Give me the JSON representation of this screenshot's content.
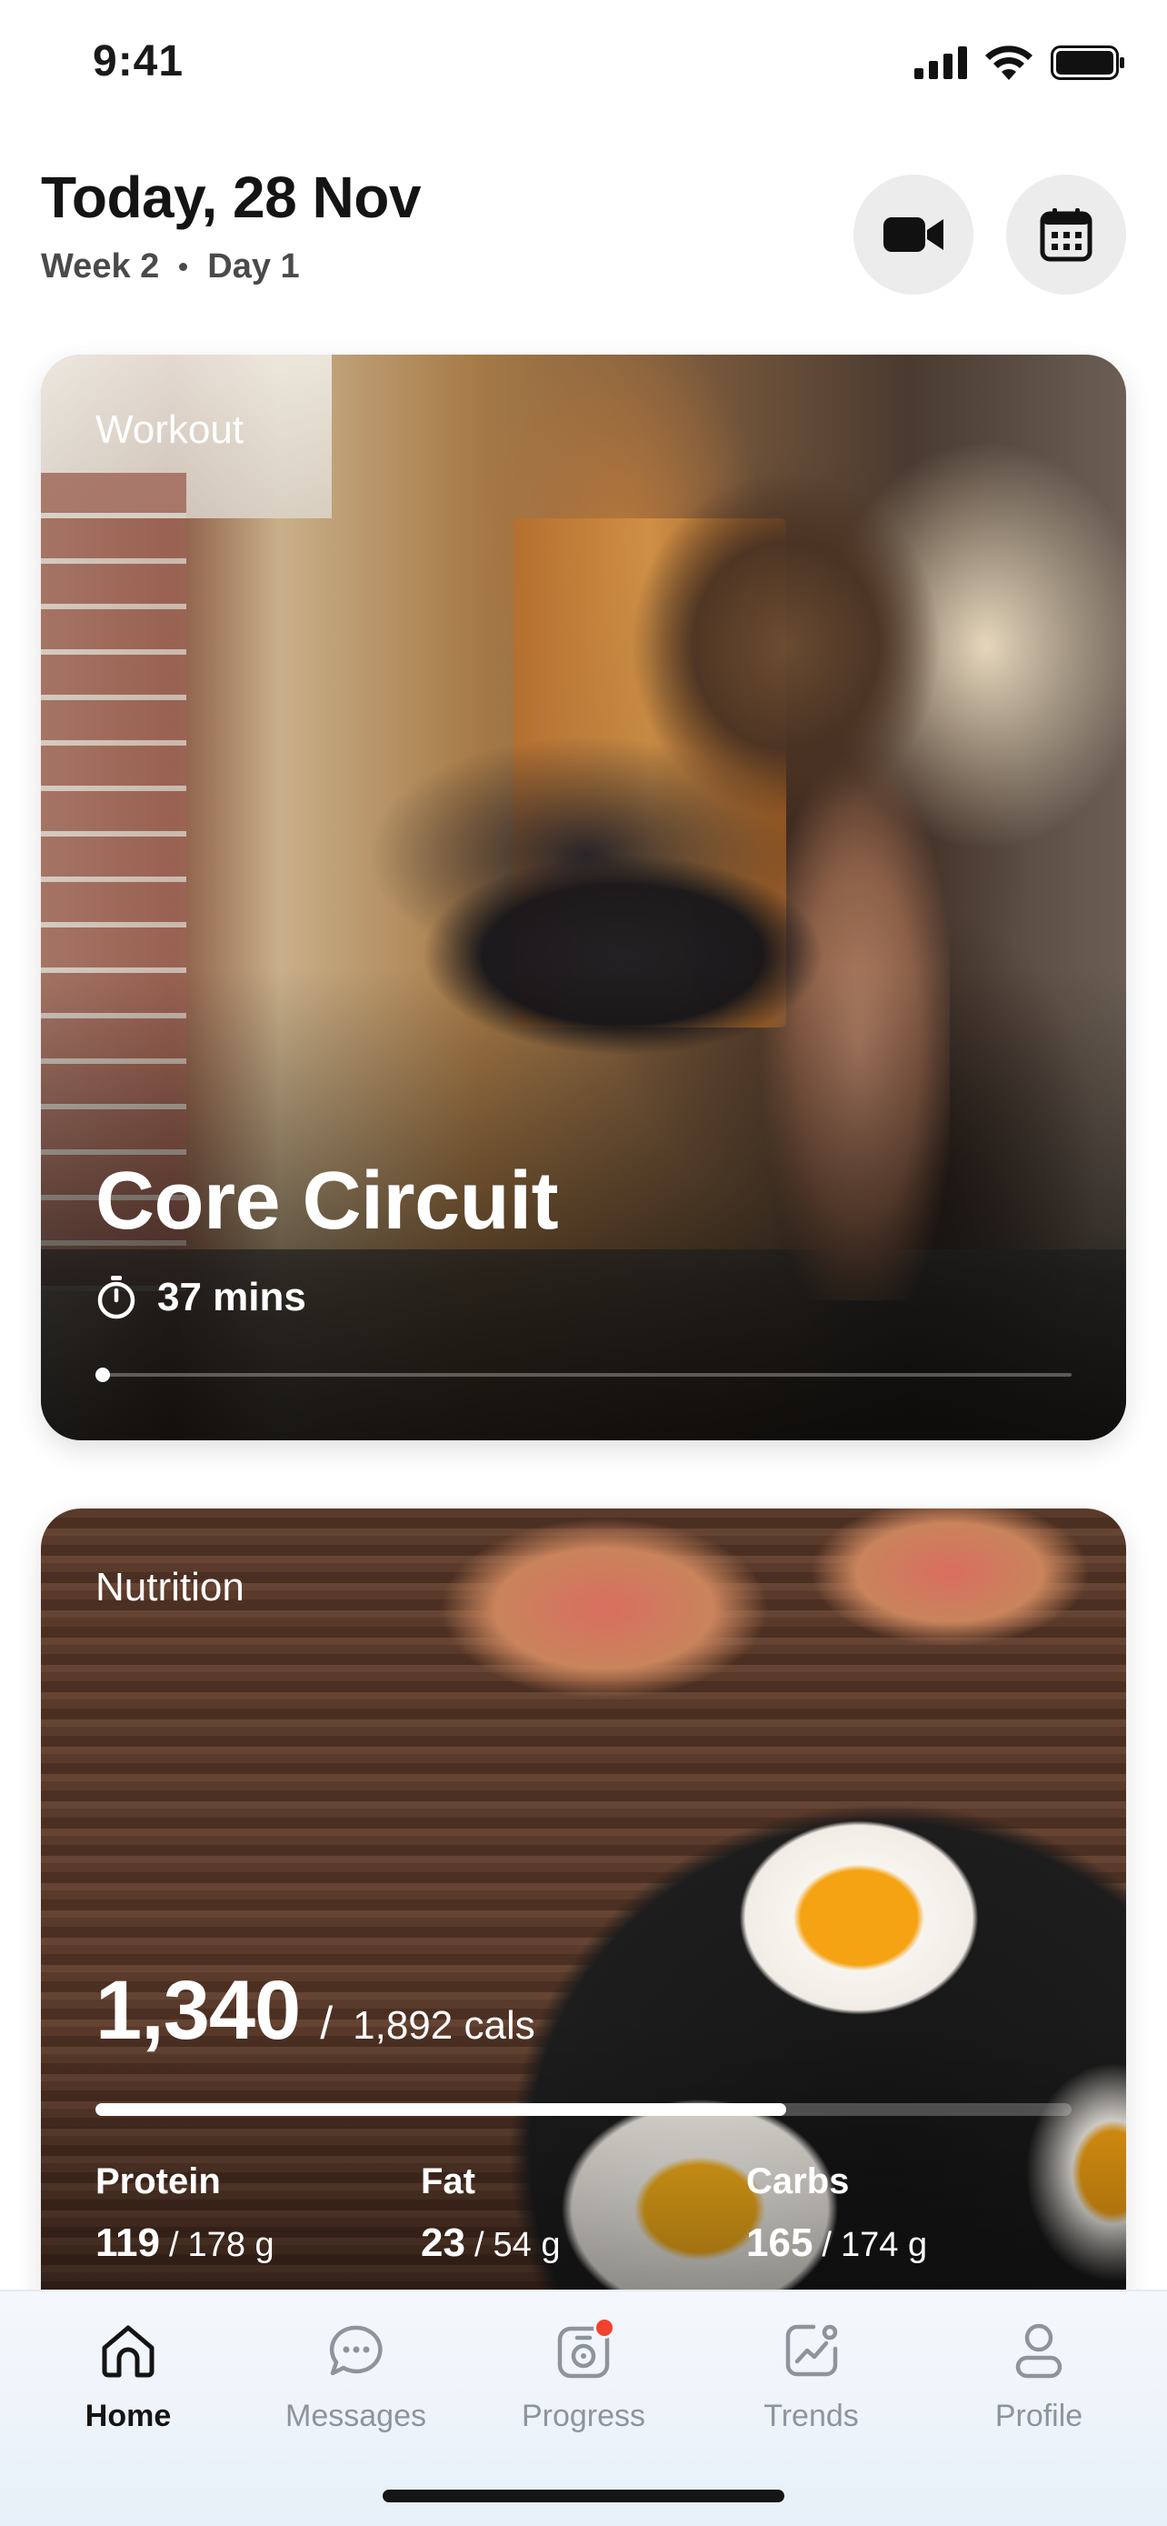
{
  "status_bar": {
    "time": "9:41"
  },
  "header": {
    "title": "Today, 28 Nov",
    "week": "Week 2",
    "day": "Day 1"
  },
  "workout": {
    "label": "Workout",
    "title": "Core Circuit",
    "duration": "37 mins",
    "progress": 0.0
  },
  "nutrition": {
    "label": "Nutrition",
    "calories": "1,340",
    "calories_goal": "1,892 cals",
    "calories_fraction": 0.708,
    "macros": [
      {
        "name": "Protein",
        "current": "119",
        "goal": "178 g"
      },
      {
        "name": "Fat",
        "current": "23",
        "goal": "54 g"
      },
      {
        "name": "Carbs",
        "current": "165",
        "goal": "174 g"
      }
    ]
  },
  "tabs": [
    {
      "label": "Home",
      "icon": "home-icon",
      "active": true
    },
    {
      "label": "Messages",
      "icon": "messages-icon",
      "active": false
    },
    {
      "label": "Progress",
      "icon": "progress-icon",
      "active": false,
      "badge": true
    },
    {
      "label": "Trends",
      "icon": "trends-icon",
      "active": false
    },
    {
      "label": "Profile",
      "icon": "profile-icon",
      "active": false
    }
  ],
  "colors": {
    "badge": "#f2432f",
    "tab_inactive": "#8e949c",
    "tab_active": "#141414",
    "button_bg": "#ececec"
  }
}
